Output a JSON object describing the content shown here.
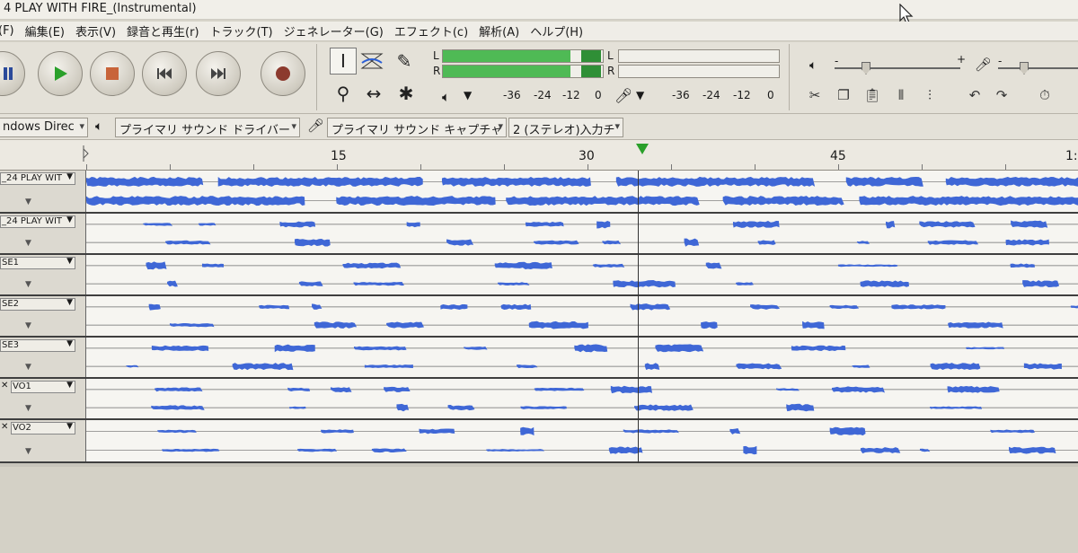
{
  "window": {
    "title": "4 PLAY WITH FIRE_(Instrumental)"
  },
  "menu": [
    "(F)",
    "編集(E)",
    "表示(V)",
    "録音と再生(r)",
    "トラック(T)",
    "ジェネレーター(G)",
    "エフェクト(c)",
    "解析(A)",
    "ヘルプ(H)"
  ],
  "meters": {
    "left_channel": "L",
    "right_channel": "R",
    "scale_record": [
      "-36",
      "-24",
      "-12",
      "0"
    ],
    "scale_playback": [
      "-36",
      "-24",
      "-12",
      "0"
    ],
    "left_level_fraction": 0.8,
    "right_level_fraction": 0.8
  },
  "mixer": {
    "plus_label": "+",
    "minus_label": "-"
  },
  "device": {
    "host": "ndows Direc",
    "playback_device": "プライマリ サウンド ドライバー",
    "recording_device": "プライマリ サウンド キャプチャド",
    "channels": "2 (ステレオ)入力チ"
  },
  "ruler": {
    "labels": [
      "15",
      "30",
      "45",
      "1:"
    ]
  },
  "tracks": [
    {
      "name": "_24 PLAY WIT",
      "has_close": false
    },
    {
      "name": "_24 PLAY WIT",
      "has_close": false
    },
    {
      "name": "SE1",
      "has_close": false
    },
    {
      "name": "SE2",
      "has_close": false
    },
    {
      "name": "SE3",
      "has_close": false
    },
    {
      "name": "VO1",
      "has_close": true
    },
    {
      "name": "VO2",
      "has_close": true
    }
  ],
  "colors": {
    "waveform": "#3f67d6",
    "meter_green": "#4fba55",
    "play_green": "#2aa02a",
    "record_red": "#c0392b"
  },
  "icons": [
    "pause-icon",
    "play-icon",
    "stop-icon",
    "skip-start-icon",
    "skip-end-icon",
    "record-icon",
    "selection-tool-icon",
    "envelope-tool-icon",
    "draw-tool-icon",
    "zoom-tool-icon",
    "timeshift-tool-icon",
    "multi-tool-icon",
    "speaker-icon",
    "microphone-icon",
    "cut-icon",
    "copy-icon",
    "paste-icon",
    "trim-icon",
    "silence-icon",
    "undo-icon",
    "redo-icon",
    "timer-icon"
  ]
}
